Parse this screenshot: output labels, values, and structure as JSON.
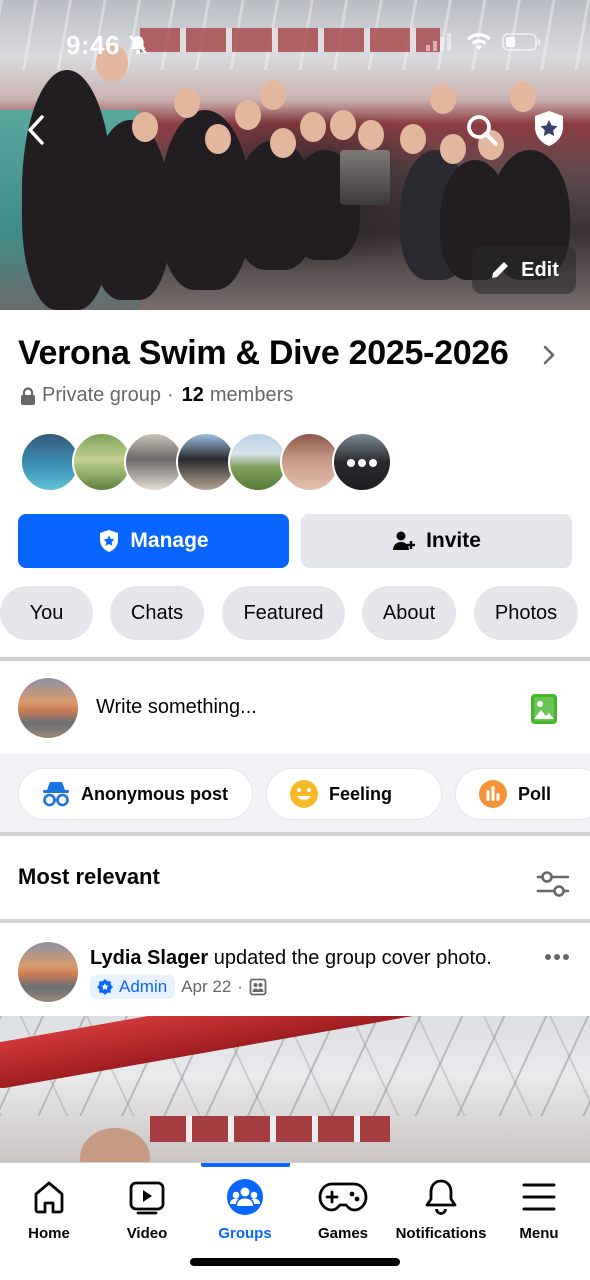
{
  "status_bar": {
    "time": "9:46"
  },
  "cover": {
    "edit_label": "Edit"
  },
  "group": {
    "name": "Verona Swim & Dive 2025-2026",
    "privacy": "Private group",
    "separator": "·",
    "member_count": "12",
    "members_label": "members"
  },
  "actions": {
    "manage_label": "Manage",
    "invite_label": "Invite"
  },
  "tabs": [
    "You",
    "Chats",
    "Featured",
    "About",
    "Photos"
  ],
  "composer": {
    "placeholder": "Write something..."
  },
  "chips": [
    "Anonymous post",
    "Feeling",
    "Poll"
  ],
  "feed": {
    "sort_title": "Most relevant"
  },
  "post": {
    "author": "Lydia Slager",
    "action": "updated the group cover photo.",
    "badge": "Admin",
    "date": "Apr 22",
    "separator": "·"
  },
  "nav": [
    "Home",
    "Video",
    "Groups",
    "Games",
    "Notifications",
    "Menu"
  ],
  "colors": {
    "accent": "#0866ff",
    "chip_bg": "#e4e6eb",
    "photo_green": "#42b72a",
    "feeling_yellow": "#f7b928",
    "poll_orange": "#f5933b"
  }
}
